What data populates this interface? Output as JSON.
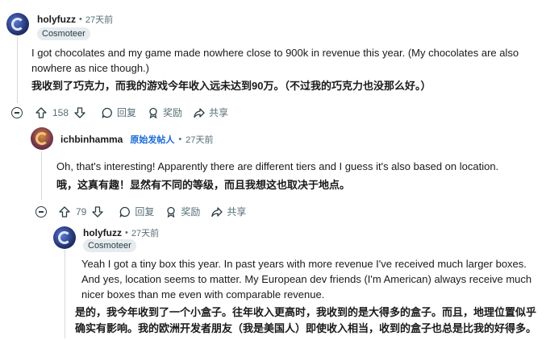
{
  "comments": [
    {
      "username": "holyfuzz",
      "time": "27天前",
      "flair": "Cosmoteer",
      "text_en": "I got chocolates and my game made nowhere close to 900k in revenue this year. (My chocolates are also nowhere as nice though.)",
      "text_zh": "我收到了巧克力，而我的游戏今年收入远未达到90万。（不过我的巧克力也没那么好。）",
      "votes": "158",
      "reply_label": "回复",
      "award_label": "奖励",
      "share_label": "共享"
    },
    {
      "username": "ichbinhamma",
      "op_badge": "原始发帖人",
      "time": "27天前",
      "text_en": "Oh, that's interesting! Apparently there are different tiers and I guess it's also based on location.",
      "text_zh": "哦，这真有趣！显然有不同的等级，而且我想这也取决于地点。",
      "votes": "79",
      "reply_label": "回复",
      "award_label": "奖励",
      "share_label": "共享"
    },
    {
      "username": "holyfuzz",
      "time": "27天前",
      "flair": "Cosmoteer",
      "text_en": "Yeah I got a tiny box this year. In past years with more revenue I've received much larger boxes. And yes, location seems to matter. My European dev friends (I'm American) always receive much nicer boxes than me even with comparable revenue.",
      "text_zh": "是的，我今年收到了一个小盒子。往年收入更高时，我收到的是大得多的盒子。而且，地理位置似乎确实有影响。我的欧洲开发者朋友（我是美国人）即使收入相当，收到的盒子也总是比我的好得多。"
    }
  ],
  "separator": "•"
}
